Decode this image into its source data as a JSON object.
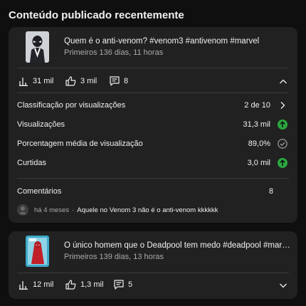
{
  "section": {
    "title": "Conteúdo publicado recentemente"
  },
  "video1": {
    "title": "Quem é o anti-venom? #venom3 #antivenom #marvel",
    "subtitle": "Primeiros 136 dias, 11 horas",
    "stats": {
      "views": "31 mil",
      "likes": "3 mil",
      "comments": "8"
    },
    "metrics": [
      {
        "label": "Classificação por visualizações",
        "value": "2 de 10",
        "icon": "chevron-right-icon"
      },
      {
        "label": "Visualizações",
        "value": "31,3 mil",
        "icon": "arrow-up-circle-icon"
      },
      {
        "label": "Porcentagem média de visualização",
        "value": "89,0%",
        "icon": "check-circle-icon"
      },
      {
        "label": "Curtidas",
        "value": "3,0 mil",
        "icon": "arrow-up-circle-icon"
      }
    ],
    "comments": {
      "label": "Comentários",
      "count": "8"
    },
    "latest_comment": {
      "time": "há 4 meses",
      "separator": "·",
      "text": "Aquele no Venom 3 não é o anti-venom kkkkkk"
    }
  },
  "video2": {
    "title": "O único homem que o Deadpool tem medo #deadpool #marvel ...",
    "subtitle": "Primeiros 139 dias, 13 horas",
    "stats": {
      "views": "12 mil",
      "likes": "1,3 mil",
      "comments": "5"
    }
  },
  "colors": {
    "background": "#0f0f0f",
    "card": "#212121",
    "positive": "#2ba640",
    "muted": "#aaaaaa"
  }
}
